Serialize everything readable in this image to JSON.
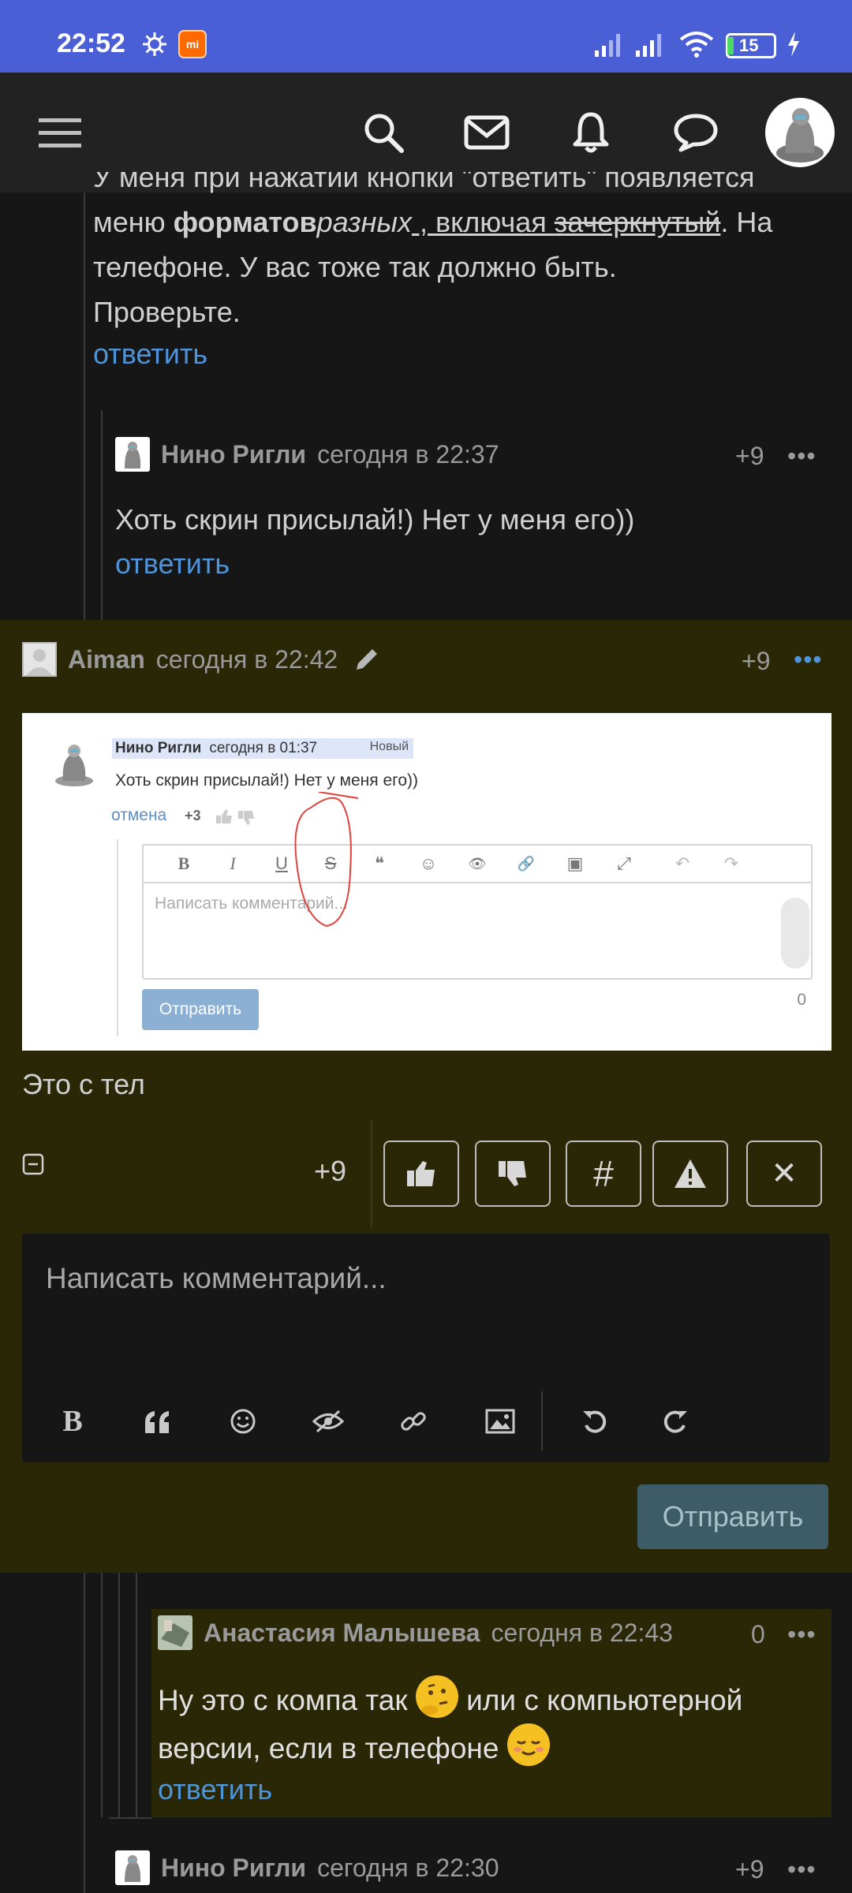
{
  "status_bar": {
    "time": "22:52",
    "mi_label": "mi",
    "battery": "15"
  },
  "nav": {
    "icons": [
      "menu-icon",
      "search-icon",
      "mail-icon",
      "bell-icon",
      "chat-icon"
    ]
  },
  "parent_comment": {
    "line1": "У меня при нажатии кнопки \"ответить\" появляется",
    "line2_pre": "меню ",
    "line2_bold": "форматов",
    "line2_italic": "разных",
    "line2_underline": " , включая ",
    "line2_strike": "зачеркнутый",
    "line2_post": ". На",
    "line3": "телефоне. У вас тоже так должно быть.",
    "line4": "Проверьте.",
    "reply": "ответить"
  },
  "comment_nino_1": {
    "author": "Нино Ригли",
    "date": "сегодня в 22:37",
    "score": "+9",
    "more": "•••",
    "text": "Хоть скрин присылай!) Нет у меня его))",
    "reply": "ответить"
  },
  "comment_aiman": {
    "author": "Aiman",
    "date": "сегодня в 22:42",
    "score": "+9",
    "more": "•••",
    "text": "Это с тел",
    "embedded": {
      "name": "Нино Ригли",
      "date": "сегодня в 01:37",
      "badge": "Новый",
      "text": "Хоть скрин присылай!) Нет у меня его))",
      "cancel": "отмена",
      "score": "+3",
      "toolbar": [
        "B",
        "I",
        "U",
        "S",
        "❝",
        "☺",
        "👁",
        "🔗",
        "▣",
        "⤢",
        "↶",
        "↷"
      ],
      "placeholder": "Написать комментарий...",
      "send": "Отправить",
      "count": "0"
    },
    "actions_score": "+9",
    "hash": "#",
    "warning": "⚠",
    "close": "✕"
  },
  "editor": {
    "placeholder": "Написать комментарий...",
    "send": "Отправить",
    "tools": [
      "bold-icon",
      "quote-icon",
      "smile-icon",
      "spoiler-icon",
      "link-icon",
      "image-icon",
      "undo-icon",
      "redo-icon"
    ]
  },
  "comment_anastasia": {
    "author": "Анастасия Малышева",
    "date": "сегодня в 22:43",
    "score": "0",
    "more": "•••",
    "text_part1": "Ну это с компа так",
    "text_part2": "или с компьютерной",
    "text_part3": "версии, если в телефоне",
    "reply": "ответить"
  },
  "comment_nino_2": {
    "author": "Нино Ригли",
    "date": "сегодня в 22:30",
    "score": "+9",
    "more": "•••"
  }
}
